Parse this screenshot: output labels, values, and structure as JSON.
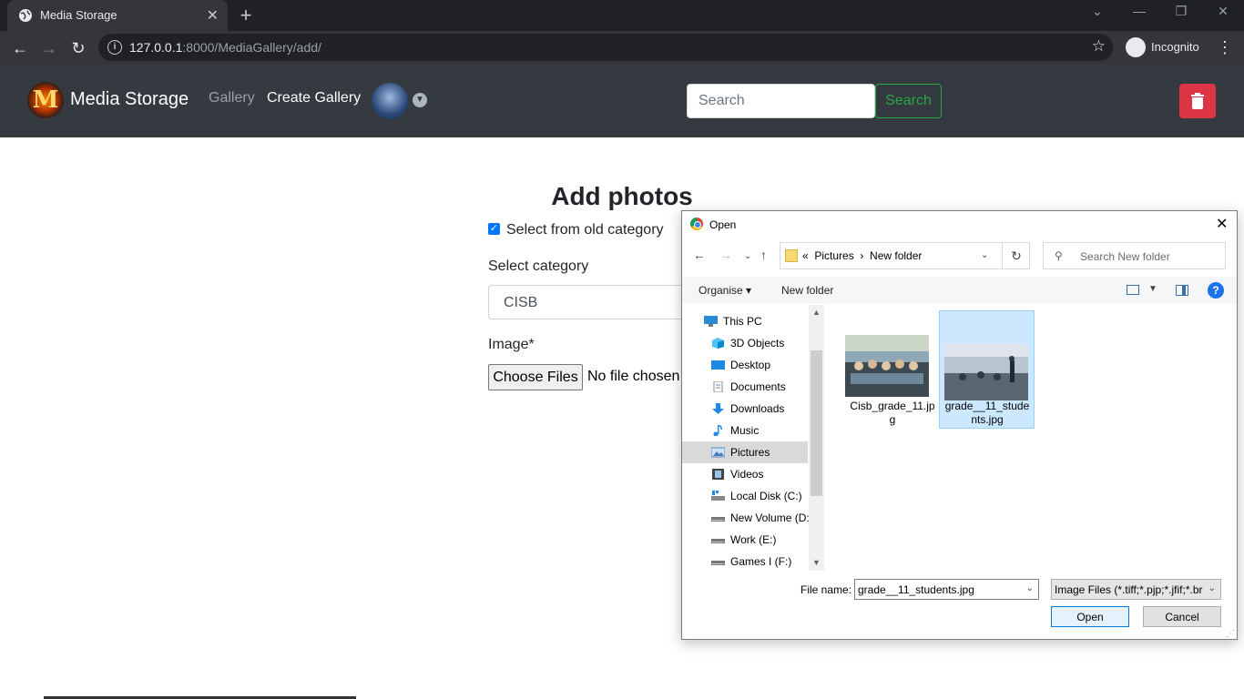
{
  "browser": {
    "tab_title": "Media Storage",
    "tab_close": "✕",
    "new_tab": "+",
    "url_host": "127.0.0.1",
    "url_path": ":8000/MediaGallery/add/",
    "incognito_label": "Incognito"
  },
  "navbar": {
    "logo_letter": "M",
    "brand": "Media Storage",
    "links": [
      {
        "label": "Gallery",
        "color": "#9aa0a6"
      },
      {
        "label": "Create Gallery",
        "color": "#ffffff"
      }
    ],
    "search_placeholder": "Search",
    "search_button": "Search",
    "accent_success": "#28a745",
    "accent_danger": "#dc3545"
  },
  "form": {
    "heading": "Add photos",
    "checkbox_label": "Select from old category",
    "checkbox_checked": true,
    "category_label": "Select category",
    "category_value": "CISB",
    "image_label": "Image*",
    "choose_files": "Choose Files",
    "no_file": "No file chosen"
  },
  "dialog": {
    "title": "Open",
    "breadcrumb": [
      "Pictures",
      "New folder"
    ],
    "search_placeholder": "Search New folder",
    "organise": "Organise ▾",
    "new_folder": "New folder",
    "help": "?",
    "tree": [
      {
        "label": "This PC",
        "icon": "pc-icon"
      },
      {
        "label": "3D Objects",
        "icon": "cube-icon"
      },
      {
        "label": "Desktop",
        "icon": "desktop-icon"
      },
      {
        "label": "Documents",
        "icon": "document-icon"
      },
      {
        "label": "Downloads",
        "icon": "download-icon"
      },
      {
        "label": "Music",
        "icon": "music-icon"
      },
      {
        "label": "Pictures",
        "icon": "pictures-icon",
        "selected": true
      },
      {
        "label": "Videos",
        "icon": "video-icon"
      },
      {
        "label": "Local Disk (C:)",
        "icon": "disk-icon"
      },
      {
        "label": "New Volume (D:",
        "icon": "drive-icon"
      },
      {
        "label": "Work (E:)",
        "icon": "drive-icon"
      },
      {
        "label": "Games I (F:)",
        "icon": "drive-icon"
      }
    ],
    "files": [
      {
        "name": "Cisb_grade_11.jpg",
        "selected": false
      },
      {
        "name": "grade__11_students.jpg",
        "selected": true
      }
    ],
    "file_name_label": "File name:",
    "file_name_value": "grade__11_students.jpg",
    "file_type": "Image Files (*.tiff;*.pjp;*.jfif;*.br",
    "open_button": "Open",
    "cancel_button": "Cancel"
  }
}
